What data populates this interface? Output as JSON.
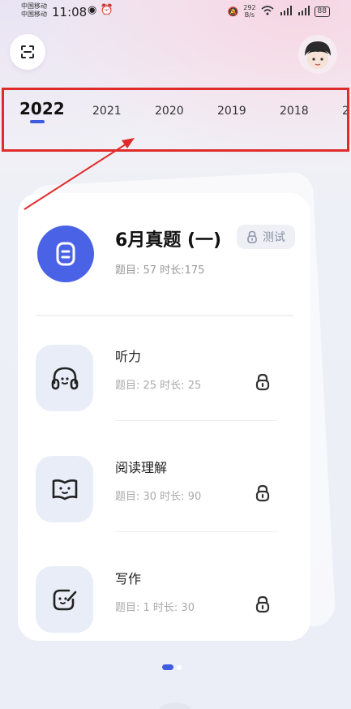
{
  "status": {
    "carrier1": "中国移动",
    "carrier2": "中国移动",
    "time": "11:08",
    "speed_value": "292",
    "speed_unit": "B/s",
    "battery": "88"
  },
  "years": {
    "active": "2022",
    "items": [
      "2021",
      "2020",
      "2019",
      "2018",
      "2"
    ]
  },
  "exam": {
    "title": "6月真题 (一)",
    "meta": "题目:  57    时长:175",
    "test_label": "测试"
  },
  "sections": [
    {
      "title": "听力",
      "meta": "题目:  25    时长:  25",
      "icon": "headphones-icon"
    },
    {
      "title": "阅读理解",
      "meta": "题目:  30    时长:  90",
      "icon": "book-face-icon"
    },
    {
      "title": "写作",
      "meta": "题目:  1    时长:  30",
      "icon": "write-face-icon"
    }
  ],
  "colors": {
    "accent": "#4a63e6",
    "highlight": "#e02b2b",
    "icon_bg": "#e9edf8"
  }
}
